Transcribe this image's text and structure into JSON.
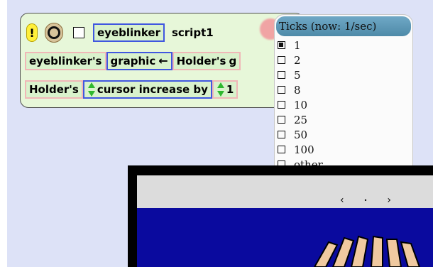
{
  "script": {
    "alert_glyph": "!",
    "object_name": "eyeblinker",
    "script_name": "script1",
    "row2": {
      "owner": "eyeblinker's",
      "property": "graphic",
      "assign_arrow": "←",
      "holder": "Holder's",
      "cut": "g"
    },
    "row3": {
      "holder": "Holder's",
      "command": "cursor increase by",
      "cut": "1"
    }
  },
  "ticks_menu": {
    "title": "Ticks (now: 1/sec)",
    "items": [
      {
        "label": "1",
        "checked": true
      },
      {
        "label": "2",
        "checked": false
      },
      {
        "label": "5",
        "checked": false
      },
      {
        "label": "8",
        "checked": false
      },
      {
        "label": "10",
        "checked": false
      },
      {
        "label": "25",
        "checked": false
      },
      {
        "label": "50",
        "checked": false
      },
      {
        "label": "100",
        "checked": false
      },
      {
        "label": "other...",
        "checked": false
      }
    ]
  },
  "frame": {
    "nav_prev": "‹",
    "nav_dot": "•",
    "nav_next": "›"
  },
  "colors": {
    "workspace": "#dde2f7",
    "tile": "#d9f2cc",
    "menu_title": "#5e98b6",
    "frame_body": "#0a0a9e"
  }
}
